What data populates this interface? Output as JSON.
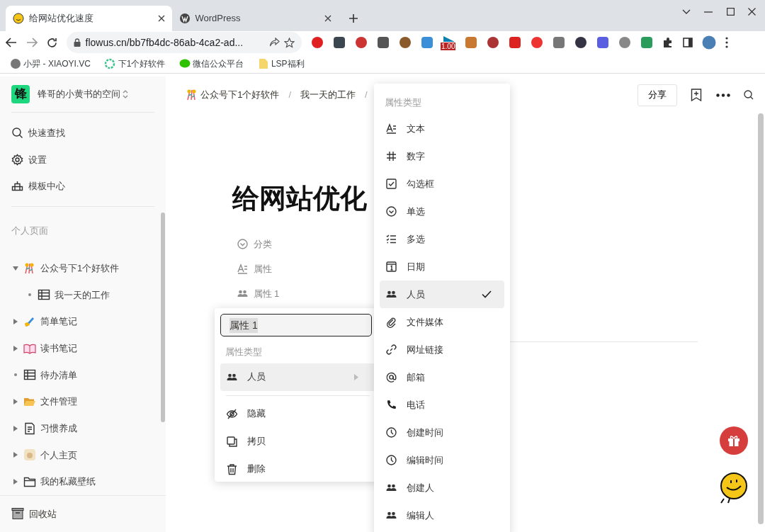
{
  "browser": {
    "tabs": [
      {
        "title": "给网站优化速度",
        "selected": true,
        "kind": "smiley"
      },
      {
        "title": "WordPress",
        "selected": false,
        "kind": "wp"
      }
    ],
    "address": "flowus.cn/bb7fb4dc-86ab-4ca2-ad...",
    "extension_badge": "1.00",
    "bookmarks": [
      {
        "label": "小羿 - XIAOYI.VC",
        "kind": "avatar"
      },
      {
        "label": "下1个好软件",
        "kind": "gear"
      },
      {
        "label": "微信公众平台",
        "kind": "chat"
      },
      {
        "label": "LSP福利",
        "kind": "folder"
      }
    ]
  },
  "sidebar": {
    "logo": "锋",
    "workspace": "锋哥的小黄书的空间",
    "nav": [
      {
        "label": "快速查找",
        "kind": "search"
      },
      {
        "label": "设置",
        "kind": "settings"
      },
      {
        "label": "模板中心",
        "kind": "template"
      }
    ],
    "section": "个人页面",
    "pages": [
      {
        "title": "公众号下1个好软件",
        "kind": "confetti",
        "expandable": true,
        "expanded": true,
        "children": [
          {
            "title": "我一天的工作",
            "kind": "table",
            "expandable": false,
            "expanded": false
          }
        ]
      },
      {
        "title": "简单笔记",
        "kind": "pencil",
        "expandable": true,
        "expanded": false
      },
      {
        "title": "读书笔记",
        "kind": "book",
        "expandable": true,
        "expanded": false
      },
      {
        "title": "待办清单",
        "kind": "table",
        "expandable": false,
        "expanded": false
      },
      {
        "title": "文件管理",
        "kind": "folder-open",
        "expandable": true,
        "expanded": false
      },
      {
        "title": "习惯养成",
        "kind": "doc",
        "expandable": true,
        "expanded": false
      },
      {
        "title": "个人主页",
        "kind": "picture",
        "expandable": true,
        "expanded": false
      },
      {
        "title": "我的私藏壁纸",
        "kind": "folder",
        "expandable": true,
        "expanded": false
      }
    ],
    "trash": "回收站"
  },
  "breadcrumb": [
    {
      "label": "公众号下1个好软件",
      "kind": "confetti",
      "separator": "/"
    },
    {
      "label": "我一天的工作",
      "kind": "plain",
      "separator": "/"
    }
  ],
  "share": "分享",
  "page_title": "给网站优化",
  "properties": [
    {
      "label": "分类",
      "kind": "select"
    },
    {
      "label": "属性",
      "kind": "text"
    },
    {
      "label": "属性 1",
      "kind": "person"
    }
  ],
  "property_editor": {
    "name": "属性 1",
    "heading": "属性类型",
    "type": {
      "label": "人员",
      "kind": "person"
    },
    "actions": [
      {
        "label": "隐藏",
        "kind": "hide"
      },
      {
        "label": "拷贝",
        "kind": "copy"
      },
      {
        "label": "删除",
        "kind": "delete"
      }
    ]
  },
  "type_menu": {
    "heading": "属性类型",
    "items": [
      {
        "label": "文本",
        "kind": "text",
        "selected": false
      },
      {
        "label": "数字",
        "kind": "number",
        "selected": false
      },
      {
        "label": "勾选框",
        "kind": "checkbox",
        "selected": false
      },
      {
        "label": "单选",
        "kind": "select",
        "selected": false
      },
      {
        "label": "多选",
        "kind": "multi",
        "selected": false
      },
      {
        "label": "日期",
        "kind": "date",
        "selected": false
      },
      {
        "label": "人员",
        "kind": "person",
        "selected": true
      },
      {
        "label": "文件媒体",
        "kind": "file",
        "selected": false
      },
      {
        "label": "网址链接",
        "kind": "url",
        "selected": false
      },
      {
        "label": "邮箱",
        "kind": "email",
        "selected": false
      },
      {
        "label": "电话",
        "kind": "phone",
        "selected": false
      },
      {
        "label": "创建时间",
        "kind": "clock",
        "selected": false
      },
      {
        "label": "编辑时间",
        "kind": "clock",
        "selected": false
      },
      {
        "label": "创建人",
        "kind": "person",
        "selected": false
      },
      {
        "label": "编辑人",
        "kind": "person",
        "selected": false
      }
    ]
  }
}
